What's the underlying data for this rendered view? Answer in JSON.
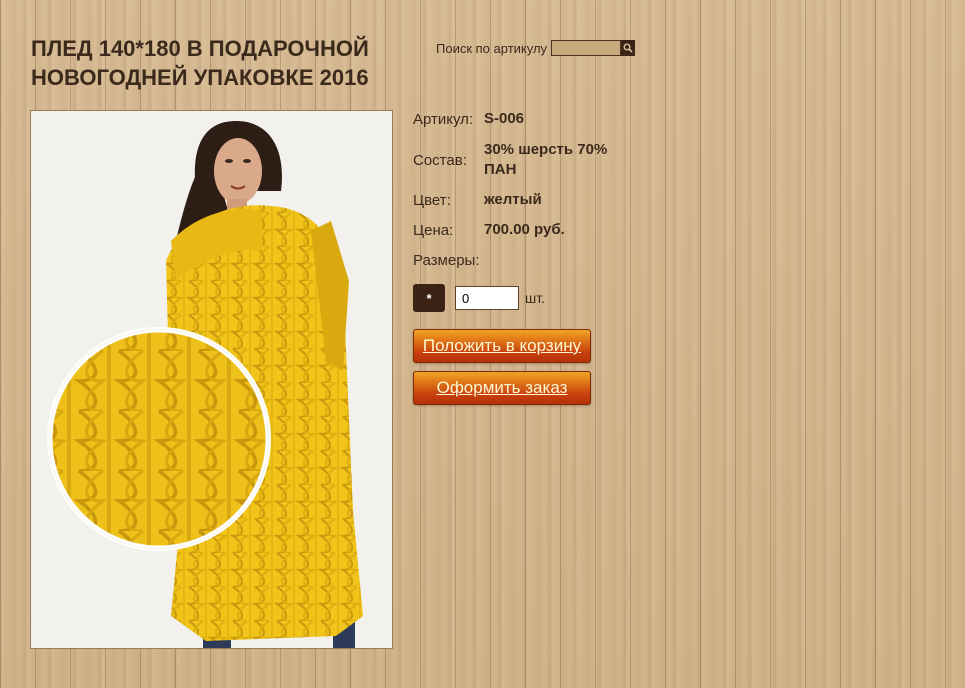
{
  "product": {
    "title": "ПЛЕД 140*180 В ПОДАРОЧНОЙ НОВОГОДНЕЙ УПАКОВКЕ 2016",
    "photo_alt": "Плед 140*180 в подарочной новогодней упаковке 2016"
  },
  "search": {
    "label": "Поиск по артикулу",
    "value": "",
    "placeholder": "",
    "icon": "search-icon"
  },
  "details": {
    "article_label": "Артикул:",
    "article_value": "S-006",
    "composition_label": "Состав:",
    "composition_value": "30% шерсть 70% ПАН",
    "color_label": "Цвет:",
    "color_value": "желтый",
    "price_label": "Цена:",
    "price_value": "700.00 руб.",
    "sizes_label": "Размеры:"
  },
  "order": {
    "size_option": "*",
    "quantity": "0",
    "unit": "шт.",
    "add_to_cart": "Положить в корзину",
    "checkout": "Оформить заказ"
  },
  "colors": {
    "background": "#d3b68e",
    "text": "#3b2a1c",
    "button": "#d2500f",
    "accent_dark": "#3b2214",
    "product_yellow": "#f0c419"
  }
}
